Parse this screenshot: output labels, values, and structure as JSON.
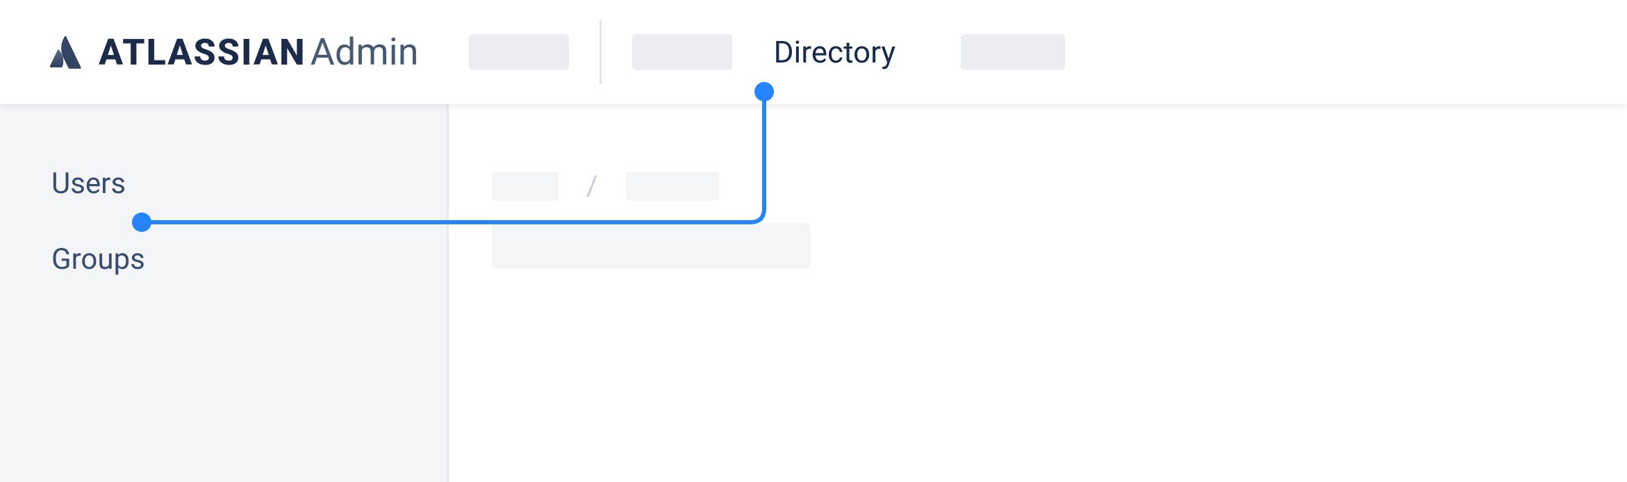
{
  "brand": {
    "name": "ATLASSIAN",
    "suffix": "Admin"
  },
  "nav": {
    "directory_label": "Directory"
  },
  "sidebar": {
    "users_label": "Users",
    "groups_label": "Groups"
  },
  "breadcrumb": {
    "separator": "/"
  },
  "colors": {
    "accent": "#2684ff",
    "text_primary": "#172b4d",
    "text_secondary": "#475973",
    "surface_subtle": "#f4f5f7"
  }
}
